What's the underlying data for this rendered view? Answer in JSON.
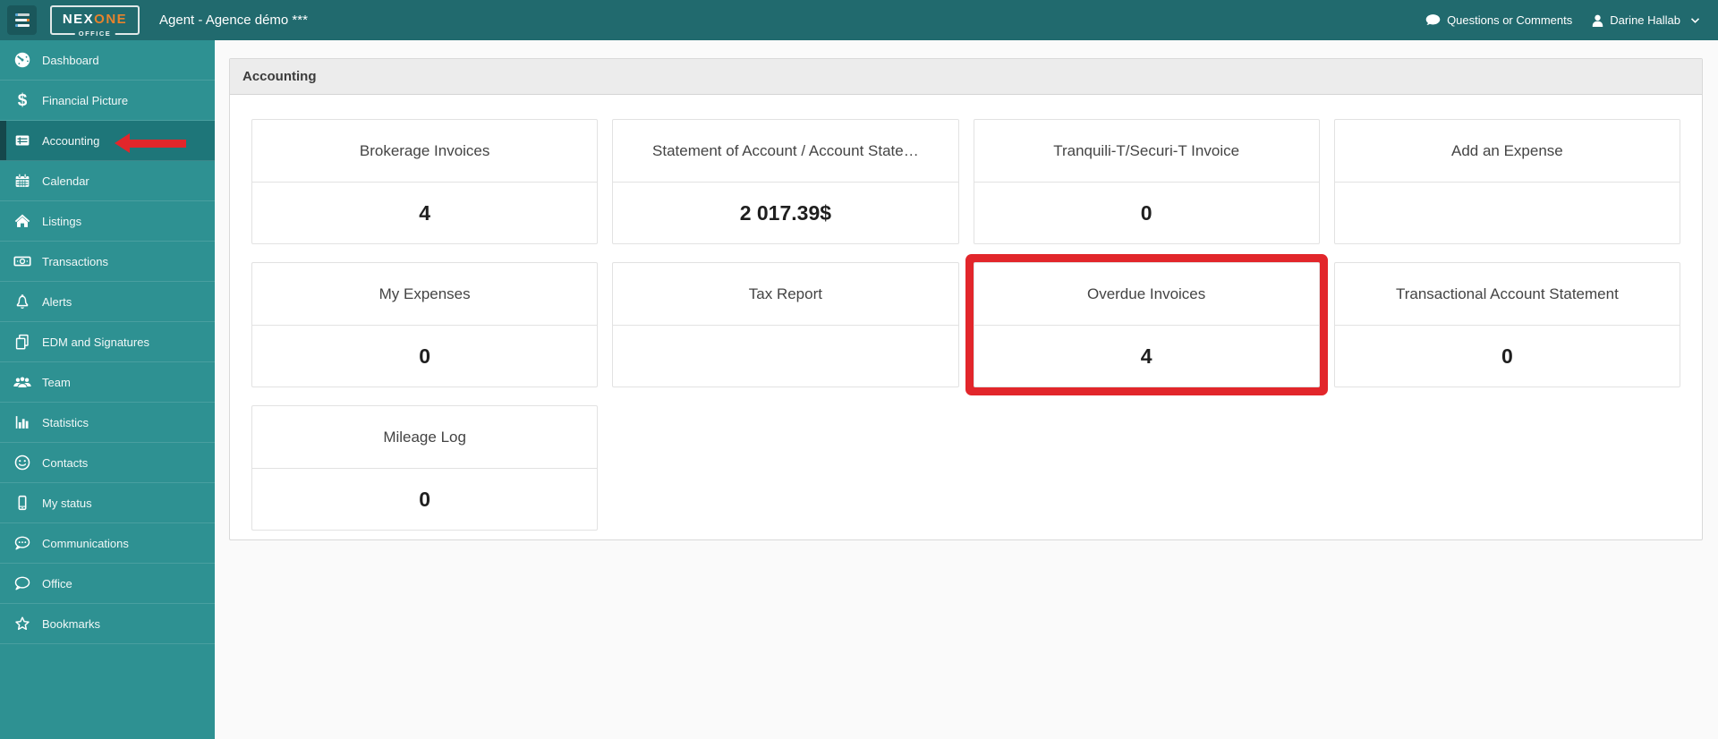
{
  "header": {
    "logo_part1": "NEX",
    "logo_part2": "ONE",
    "logo_sub": "OFFICE",
    "title": "Agent - Agence démo ***",
    "questions_label": "Questions or Comments",
    "user_name": "Darine Hallab"
  },
  "sidebar": {
    "items": [
      {
        "label": "Dashboard",
        "icon": "gauge-icon",
        "active": false
      },
      {
        "label": "Financial Picture",
        "icon": "dollar-icon",
        "active": false
      },
      {
        "label": "Accounting",
        "icon": "ledger-icon",
        "active": true
      },
      {
        "label": "Calendar",
        "icon": "calendar-icon",
        "active": false
      },
      {
        "label": "Listings",
        "icon": "home-icon",
        "active": false
      },
      {
        "label": "Transactions",
        "icon": "money-bill-icon",
        "active": false
      },
      {
        "label": "Alerts",
        "icon": "bell-icon",
        "active": false
      },
      {
        "label": "EDM and Signatures",
        "icon": "copy-icon",
        "active": false
      },
      {
        "label": "Team",
        "icon": "users-icon",
        "active": false
      },
      {
        "label": "Statistics",
        "icon": "bar-chart-icon",
        "active": false
      },
      {
        "label": "Contacts",
        "icon": "smiley-icon",
        "active": false
      },
      {
        "label": "My status",
        "icon": "mobile-icon",
        "active": false
      },
      {
        "label": "Communications",
        "icon": "chat-dots-icon",
        "active": false
      },
      {
        "label": "Office",
        "icon": "chat-bubble-icon",
        "active": false
      },
      {
        "label": "Bookmarks",
        "icon": "star-icon",
        "active": false
      }
    ]
  },
  "main": {
    "panel_title": "Accounting",
    "cards": [
      {
        "label": "Brokerage Invoices",
        "value": "4",
        "highlighted": false
      },
      {
        "label": "Statement of Account / Account State…",
        "value": "2 017.39$",
        "highlighted": false
      },
      {
        "label": "Tranquili-T/Securi-T Invoice",
        "value": "0",
        "highlighted": false
      },
      {
        "label": "Add an Expense",
        "value": "",
        "highlighted": false
      },
      {
        "label": "My Expenses",
        "value": "0",
        "highlighted": false
      },
      {
        "label": "Tax Report",
        "value": "",
        "highlighted": false
      },
      {
        "label": "Overdue Invoices",
        "value": "4",
        "highlighted": true
      },
      {
        "label": "Transactional Account Statement",
        "value": "0",
        "highlighted": false
      },
      {
        "label": "Mileage Log",
        "value": "0",
        "highlighted": false
      }
    ]
  },
  "annotations": {
    "arrow_target": "sidebar-item-accounting",
    "box_target": "card-overdue-invoices",
    "color": "#e2262b"
  },
  "colors": {
    "header_teal": "#216a6e",
    "sidebar_teal": "#2e9192",
    "active_item_teal": "#1e7679",
    "active_strip": "#15474b",
    "brand_orange": "#e8832c",
    "annotation_red": "#e2262b",
    "panel_header_gray": "#ececec"
  }
}
